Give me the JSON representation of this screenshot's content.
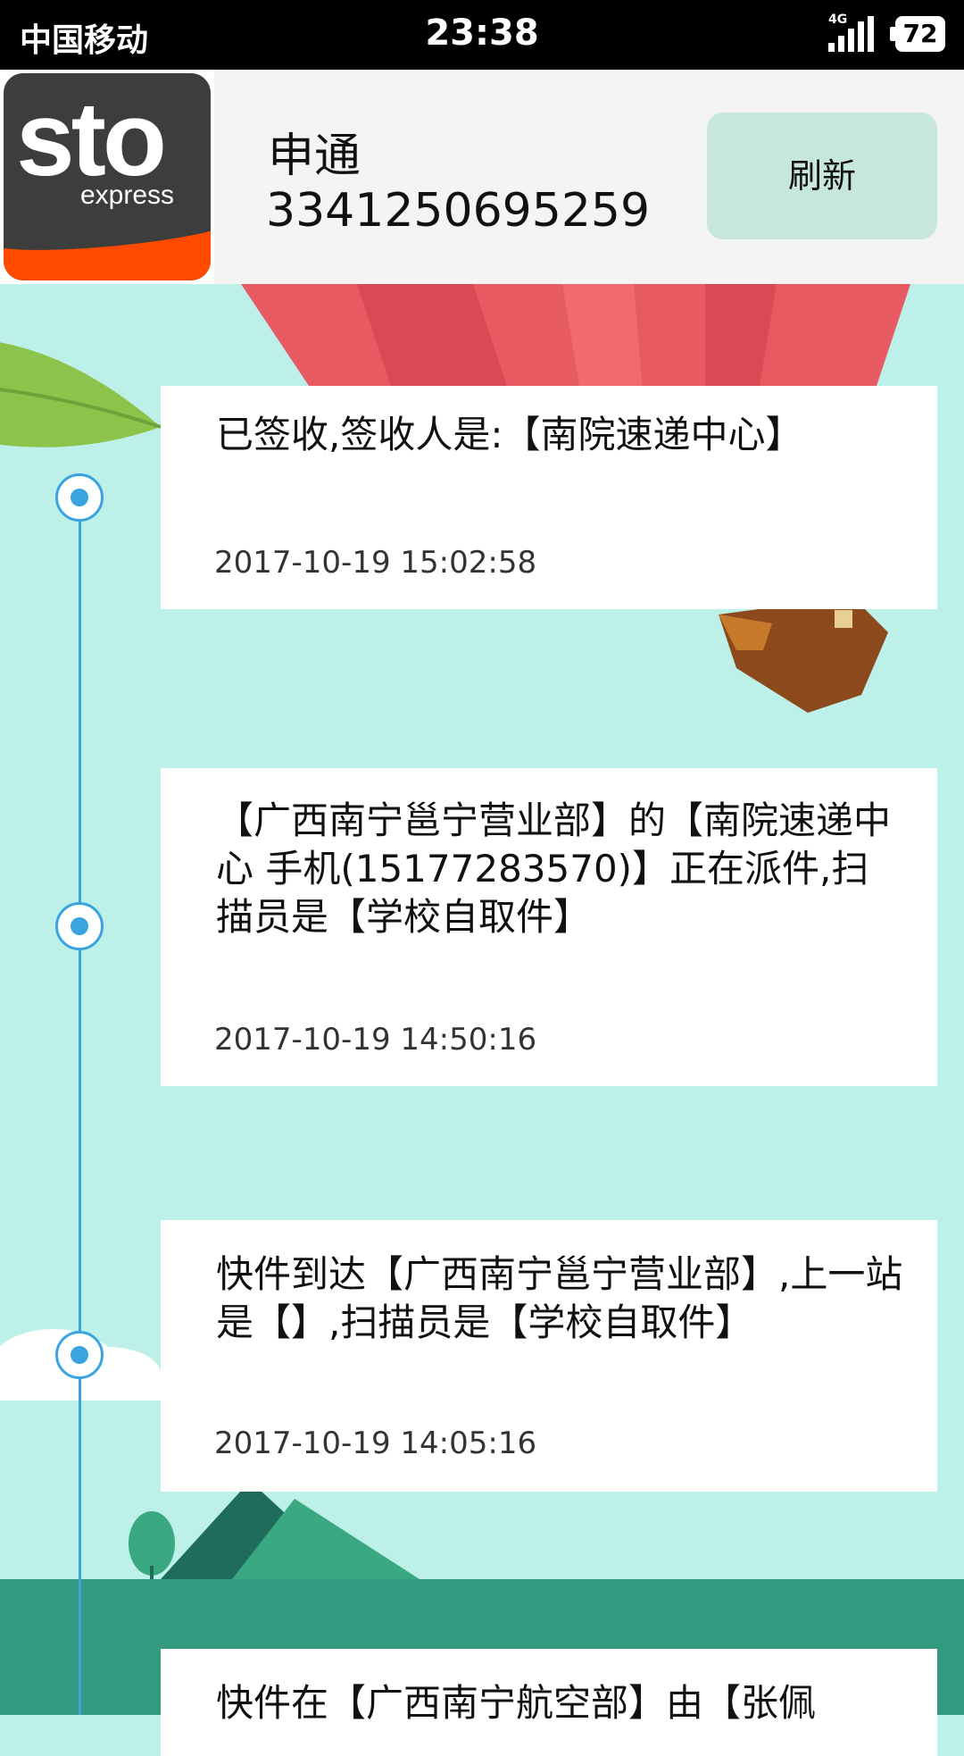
{
  "status_bar": {
    "carrier": "中国移动",
    "time": "23:38",
    "network": "4G",
    "battery": "72"
  },
  "header": {
    "logo_text": "sto",
    "logo_sub": "express",
    "company": "申通",
    "tracking_number": "3341250695259",
    "refresh_label": "刷新"
  },
  "timeline": [
    {
      "text": "已签收,签收人是:【南院速递中心】",
      "time": "2017-10-19 15:02:58"
    },
    {
      "text": "【广西南宁邕宁营业部】的【南院速递中心 手机(15177283570)】正在派件,扫描员是【学校自取件】",
      "time": "2017-10-19 14:50:16"
    },
    {
      "text": "快件到达【广西南宁邕宁营业部】,上一站是【】,扫描员是【学校自取件】",
      "time": "2017-10-19 14:05:16"
    },
    {
      "text": "快件在【广西南宁航空部】由【张佩",
      "time": ""
    }
  ],
  "colors": {
    "background": "#bdf0e9",
    "accent": "#3aa3e0",
    "button": "#c7e6de",
    "logo_orange": "#ff4a00"
  }
}
